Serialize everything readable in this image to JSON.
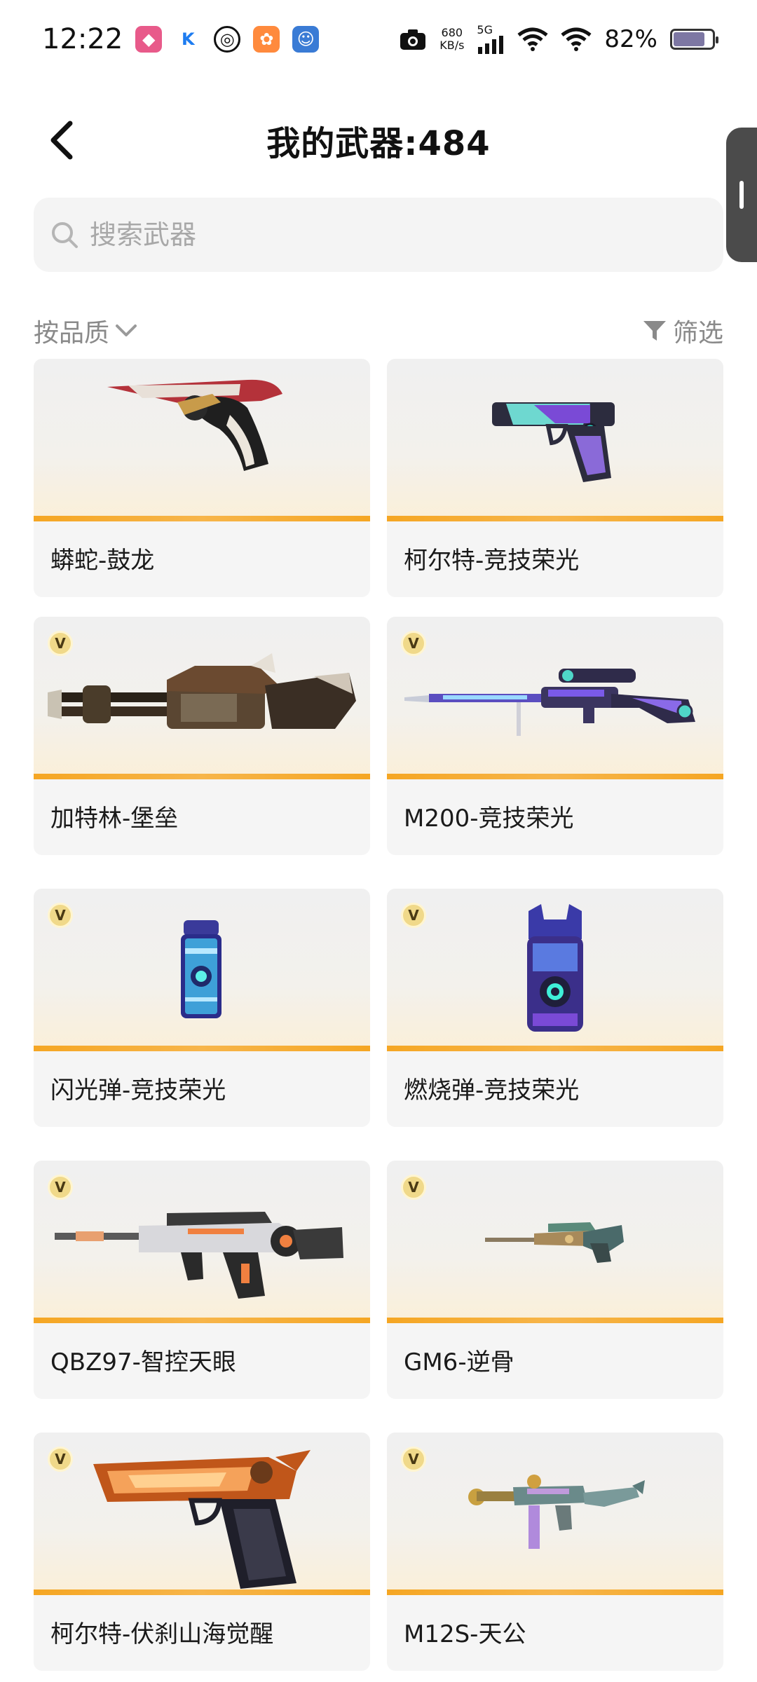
{
  "status": {
    "time": "12:22",
    "net_speed_value": "680",
    "net_speed_unit": "KB/s",
    "network": "5G",
    "battery": "82%",
    "battery_level": 0.82
  },
  "header": {
    "title": "我的武器:484"
  },
  "search": {
    "placeholder": "搜索武器"
  },
  "filters": {
    "sort_label": "按品质",
    "filter_label": "筛选"
  },
  "badge_letter": "V",
  "weapons": [
    {
      "name": "蟒蛇-鼓龙",
      "icon": "revolver-icon"
    },
    {
      "name": "柯尔特-竞技荣光",
      "icon": "pistol-icon"
    },
    {
      "name": "加特林-堡垒",
      "icon": "gatling-icon"
    },
    {
      "name": "M200-竞技荣光",
      "icon": "sniper-icon"
    },
    {
      "name": "闪光弹-竞技荣光",
      "icon": "flashbang-icon"
    },
    {
      "name": "燃烧弹-竞技荣光",
      "icon": "incendiary-icon"
    },
    {
      "name": "QBZ97-智控天眼",
      "icon": "rifle-icon"
    },
    {
      "name": "GM6-逆骨",
      "icon": "heavy-sniper-icon"
    },
    {
      "name": "柯尔特-伏刹山海觉醒",
      "icon": "pistol-icon"
    },
    {
      "name": "M12S-天公",
      "icon": "smg-icon"
    }
  ],
  "colors": {
    "accent_orange": "#f5a623",
    "card_bg": "#f5f5f5",
    "search_bg": "#f4f4f4"
  }
}
